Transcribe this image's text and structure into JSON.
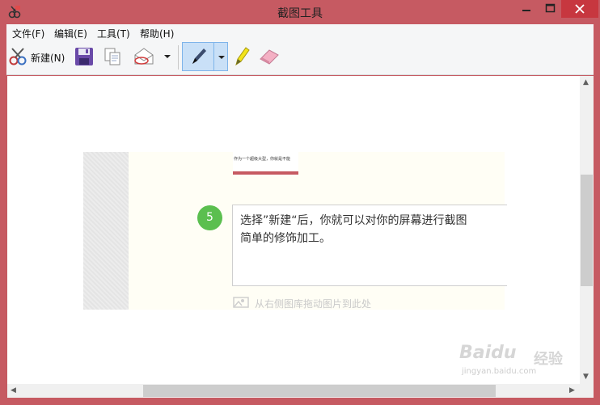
{
  "window": {
    "title": "截图工具",
    "accent_color": "#c65a62"
  },
  "menu": {
    "items": [
      "文件(F)",
      "编辑(E)",
      "工具(T)",
      "帮助(H)"
    ]
  },
  "toolbar": {
    "new_label": "新建(N)",
    "icons": [
      "scissors-icon",
      "save-icon",
      "copy-icon",
      "send-email-icon",
      "dropdown-arrow-icon",
      "pen-icon",
      "highlighter-icon",
      "eraser-icon"
    ]
  },
  "canvas": {
    "thumbnail_text": "作为一个超级大型，你就是不能",
    "step": {
      "number": "5",
      "text": "选择”新建“后，你就可以对你的屏幕进行截图",
      "text2": "简单的修饰加工。"
    },
    "drop_hint": "从右侧图库拖动图片到此处"
  },
  "watermark": {
    "brand": "Baidu",
    "cn": "经验",
    "url": "jingyan.baidu.com"
  }
}
